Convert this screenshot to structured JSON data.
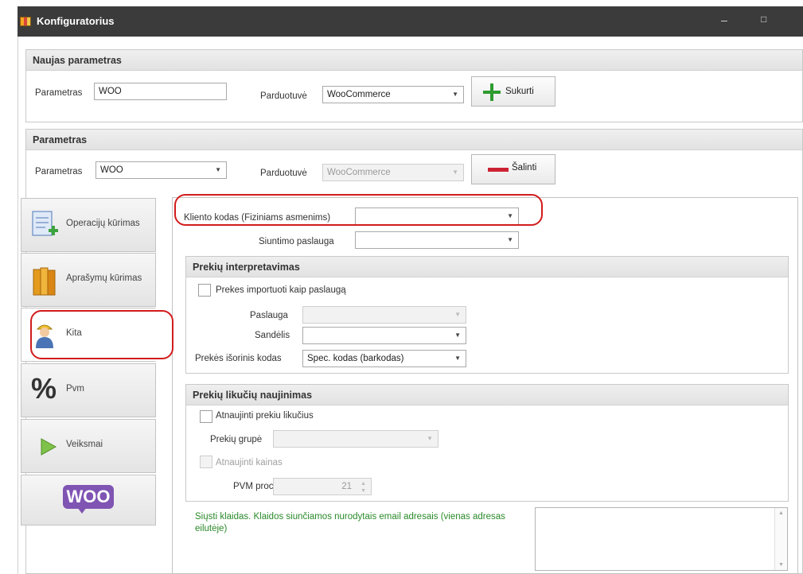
{
  "window": {
    "title": "Konfiguratorius",
    "minimize": "–",
    "maximize": "□"
  },
  "new_param": {
    "header": "Naujas parametras",
    "param_label": "Parametras",
    "param_value": "WOO",
    "shop_label": "Parduotuvė",
    "shop_value": "WooCommerce",
    "create_label": "Sukurti"
  },
  "param": {
    "header": "Parametras",
    "param_label": "Parametras",
    "param_value": "WOO",
    "shop_label": "Parduotuvė",
    "shop_value": "WooCommerce",
    "delete_label": "Šalinti"
  },
  "tabs": [
    {
      "label": "Operacijų kūrimas",
      "icon": "document-add-icon"
    },
    {
      "label": "Aprašymų kūrimas",
      "icon": "books-icon"
    },
    {
      "label": "Kita",
      "icon": "worker-icon"
    },
    {
      "label": "Pvm",
      "icon": "percent-icon"
    },
    {
      "label": "Veiksmai",
      "icon": "play-icon"
    },
    {
      "label": "",
      "icon": "woo-logo-icon",
      "logo_text": "WOO"
    }
  ],
  "kita": {
    "client_code_label": "Kliento kodas (Fiziniams asmenims)",
    "client_code_value": "",
    "shipping_label": "Siuntimo paslauga",
    "shipping_value": "",
    "products": {
      "header": "Prekių interpretavimas",
      "import_as_service_label": "Prekes importuoti kaip paslaugą",
      "service_label": "Paslauga",
      "service_value": "",
      "warehouse_label": "Sandėlis",
      "warehouse_value": "",
      "ext_code_label": "Prekės išorinis kodas",
      "ext_code_value": "Spec. kodas (barkodas)"
    },
    "stock": {
      "header": "Prekių likučių naujinimas",
      "update_stock_label": "Atnaujinti prekiu likučius",
      "group_label": "Prekių grupė",
      "group_value": "",
      "update_prices_label": "Atnaujinti kainas",
      "vat_label": "PVM proc.",
      "vat_value": "21"
    },
    "errors_label": "Siųsti klaidas. Klaidos siunčiamos nurodytais email adresais (vienas adresas eilutėje)",
    "errors_value": ""
  },
  "colors": {
    "accent_red": "#d21c1c",
    "plus_green": "#2e9b2e",
    "minus_red": "#cc2233",
    "woo_purple": "#7f54b3",
    "info_green": "#2a8a2a"
  }
}
